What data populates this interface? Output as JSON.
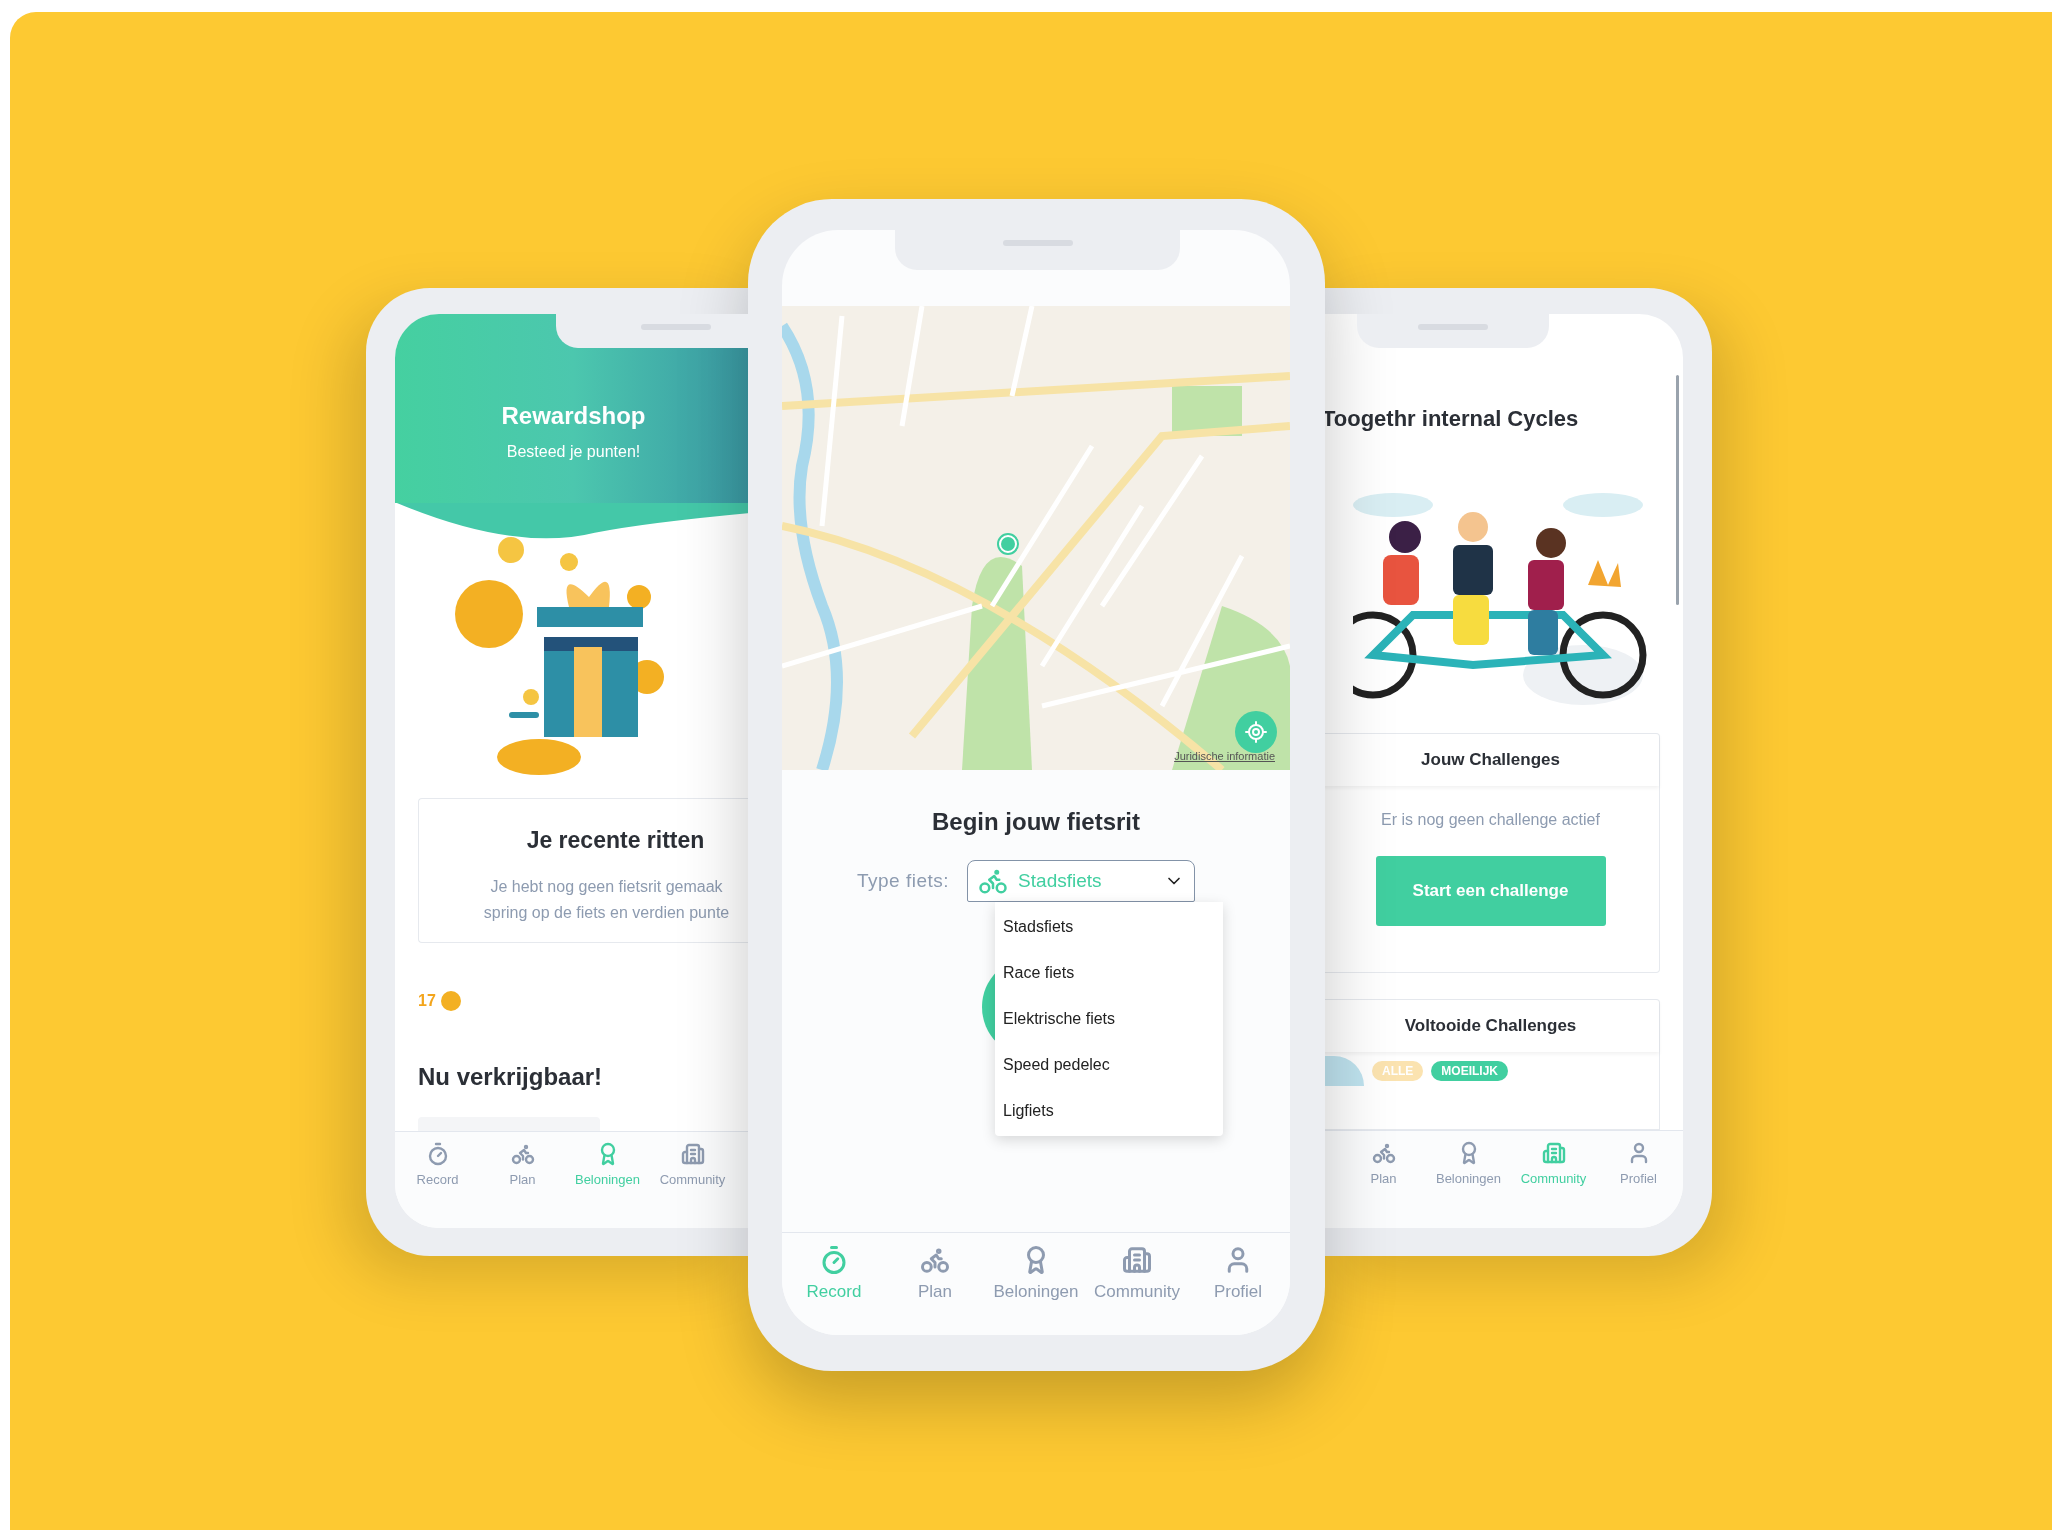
{
  "phones": [
    {
      "kind": "rewards",
      "header": {
        "title": "Rewardshop",
        "subtitle": "Besteed je punten!"
      },
      "recent_rides": {
        "title": "Je recente ritten",
        "lines": [
          "Je hebt nog geen fietsrit gemaak",
          "spring op de fiets en verdien punte"
        ]
      },
      "points": "17",
      "section_title": "Nu verkrijgbaar!",
      "nav": [
        {
          "kind": "record",
          "label": "Record",
          "selected": false
        },
        {
          "kind": "plan",
          "label": "Plan",
          "selected": false
        },
        {
          "kind": "rewards",
          "label": "Beloningen",
          "selected": true
        },
        {
          "kind": "community",
          "label": "Community",
          "selected": false
        }
      ]
    },
    {
      "kind": "record",
      "map": {
        "legal_link": "Juridische informatie"
      },
      "title": "Begin jouw fietsrit",
      "bike_type": {
        "label": "Type fiets:",
        "value": "Stadsfiets",
        "expanded": true,
        "options": [
          "Stadsfiets",
          "Race fiets",
          "Elektrische fiets",
          "Speed pedelec",
          "Ligfiets"
        ]
      },
      "nav": [
        {
          "kind": "record",
          "label": "Record",
          "selected": true
        },
        {
          "kind": "plan",
          "label": "Plan",
          "selected": false
        },
        {
          "kind": "rewards",
          "label": "Beloningen",
          "selected": false
        },
        {
          "kind": "community",
          "label": "Community",
          "selected": false
        },
        {
          "kind": "profile",
          "label": "Profiel",
          "selected": false
        }
      ]
    },
    {
      "kind": "community",
      "title": "Toogethr internal Cycles",
      "challenges": {
        "title": "Jouw Challenges",
        "empty_text": "Er is nog geen challenge actief",
        "button": "Start een challenge"
      },
      "completed": {
        "title": "Voltooide Challenges",
        "filters": [
          {
            "label": "ALLE",
            "selected": false
          },
          {
            "label": "MOEILIJK",
            "selected": true
          }
        ]
      },
      "nav": [
        {
          "kind": "plan",
          "label": "Plan",
          "selected": false
        },
        {
          "kind": "rewards",
          "label": "Beloningen",
          "selected": false
        },
        {
          "kind": "community",
          "label": "Community",
          "selected": true
        },
        {
          "kind": "profile",
          "label": "Profiel",
          "selected": false
        }
      ]
    }
  ]
}
